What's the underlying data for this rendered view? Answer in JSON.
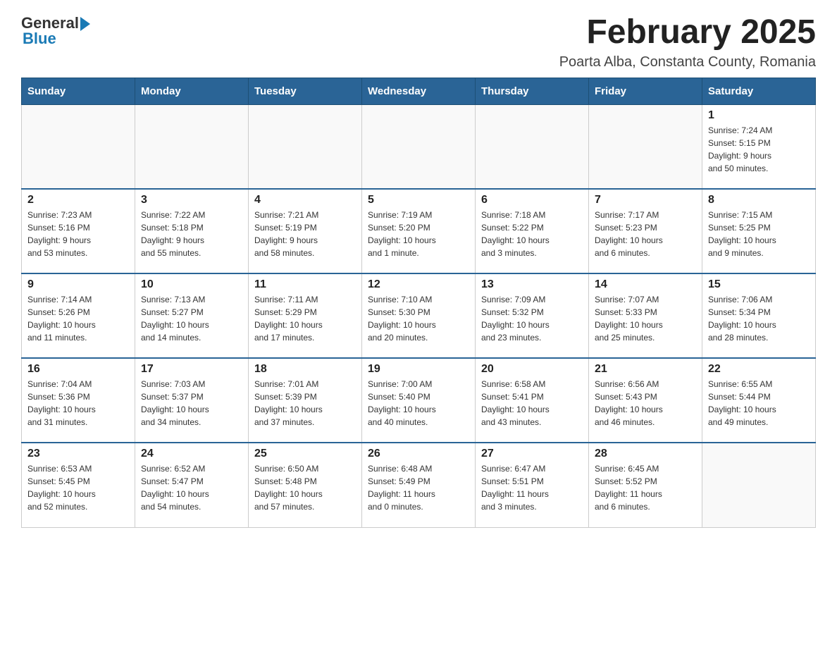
{
  "logo": {
    "general": "General",
    "blue": "Blue"
  },
  "title": "February 2025",
  "subtitle": "Poarta Alba, Constanta County, Romania",
  "header": {
    "days": [
      "Sunday",
      "Monday",
      "Tuesday",
      "Wednesday",
      "Thursday",
      "Friday",
      "Saturday"
    ]
  },
  "weeks": [
    [
      {
        "day": "",
        "info": ""
      },
      {
        "day": "",
        "info": ""
      },
      {
        "day": "",
        "info": ""
      },
      {
        "day": "",
        "info": ""
      },
      {
        "day": "",
        "info": ""
      },
      {
        "day": "",
        "info": ""
      },
      {
        "day": "1",
        "info": "Sunrise: 7:24 AM\nSunset: 5:15 PM\nDaylight: 9 hours\nand 50 minutes."
      }
    ],
    [
      {
        "day": "2",
        "info": "Sunrise: 7:23 AM\nSunset: 5:16 PM\nDaylight: 9 hours\nand 53 minutes."
      },
      {
        "day": "3",
        "info": "Sunrise: 7:22 AM\nSunset: 5:18 PM\nDaylight: 9 hours\nand 55 minutes."
      },
      {
        "day": "4",
        "info": "Sunrise: 7:21 AM\nSunset: 5:19 PM\nDaylight: 9 hours\nand 58 minutes."
      },
      {
        "day": "5",
        "info": "Sunrise: 7:19 AM\nSunset: 5:20 PM\nDaylight: 10 hours\nand 1 minute."
      },
      {
        "day": "6",
        "info": "Sunrise: 7:18 AM\nSunset: 5:22 PM\nDaylight: 10 hours\nand 3 minutes."
      },
      {
        "day": "7",
        "info": "Sunrise: 7:17 AM\nSunset: 5:23 PM\nDaylight: 10 hours\nand 6 minutes."
      },
      {
        "day": "8",
        "info": "Sunrise: 7:15 AM\nSunset: 5:25 PM\nDaylight: 10 hours\nand 9 minutes."
      }
    ],
    [
      {
        "day": "9",
        "info": "Sunrise: 7:14 AM\nSunset: 5:26 PM\nDaylight: 10 hours\nand 11 minutes."
      },
      {
        "day": "10",
        "info": "Sunrise: 7:13 AM\nSunset: 5:27 PM\nDaylight: 10 hours\nand 14 minutes."
      },
      {
        "day": "11",
        "info": "Sunrise: 7:11 AM\nSunset: 5:29 PM\nDaylight: 10 hours\nand 17 minutes."
      },
      {
        "day": "12",
        "info": "Sunrise: 7:10 AM\nSunset: 5:30 PM\nDaylight: 10 hours\nand 20 minutes."
      },
      {
        "day": "13",
        "info": "Sunrise: 7:09 AM\nSunset: 5:32 PM\nDaylight: 10 hours\nand 23 minutes."
      },
      {
        "day": "14",
        "info": "Sunrise: 7:07 AM\nSunset: 5:33 PM\nDaylight: 10 hours\nand 25 minutes."
      },
      {
        "day": "15",
        "info": "Sunrise: 7:06 AM\nSunset: 5:34 PM\nDaylight: 10 hours\nand 28 minutes."
      }
    ],
    [
      {
        "day": "16",
        "info": "Sunrise: 7:04 AM\nSunset: 5:36 PM\nDaylight: 10 hours\nand 31 minutes."
      },
      {
        "day": "17",
        "info": "Sunrise: 7:03 AM\nSunset: 5:37 PM\nDaylight: 10 hours\nand 34 minutes."
      },
      {
        "day": "18",
        "info": "Sunrise: 7:01 AM\nSunset: 5:39 PM\nDaylight: 10 hours\nand 37 minutes."
      },
      {
        "day": "19",
        "info": "Sunrise: 7:00 AM\nSunset: 5:40 PM\nDaylight: 10 hours\nand 40 minutes."
      },
      {
        "day": "20",
        "info": "Sunrise: 6:58 AM\nSunset: 5:41 PM\nDaylight: 10 hours\nand 43 minutes."
      },
      {
        "day": "21",
        "info": "Sunrise: 6:56 AM\nSunset: 5:43 PM\nDaylight: 10 hours\nand 46 minutes."
      },
      {
        "day": "22",
        "info": "Sunrise: 6:55 AM\nSunset: 5:44 PM\nDaylight: 10 hours\nand 49 minutes."
      }
    ],
    [
      {
        "day": "23",
        "info": "Sunrise: 6:53 AM\nSunset: 5:45 PM\nDaylight: 10 hours\nand 52 minutes."
      },
      {
        "day": "24",
        "info": "Sunrise: 6:52 AM\nSunset: 5:47 PM\nDaylight: 10 hours\nand 54 minutes."
      },
      {
        "day": "25",
        "info": "Sunrise: 6:50 AM\nSunset: 5:48 PM\nDaylight: 10 hours\nand 57 minutes."
      },
      {
        "day": "26",
        "info": "Sunrise: 6:48 AM\nSunset: 5:49 PM\nDaylight: 11 hours\nand 0 minutes."
      },
      {
        "day": "27",
        "info": "Sunrise: 6:47 AM\nSunset: 5:51 PM\nDaylight: 11 hours\nand 3 minutes."
      },
      {
        "day": "28",
        "info": "Sunrise: 6:45 AM\nSunset: 5:52 PM\nDaylight: 11 hours\nand 6 minutes."
      },
      {
        "day": "",
        "info": ""
      }
    ]
  ]
}
